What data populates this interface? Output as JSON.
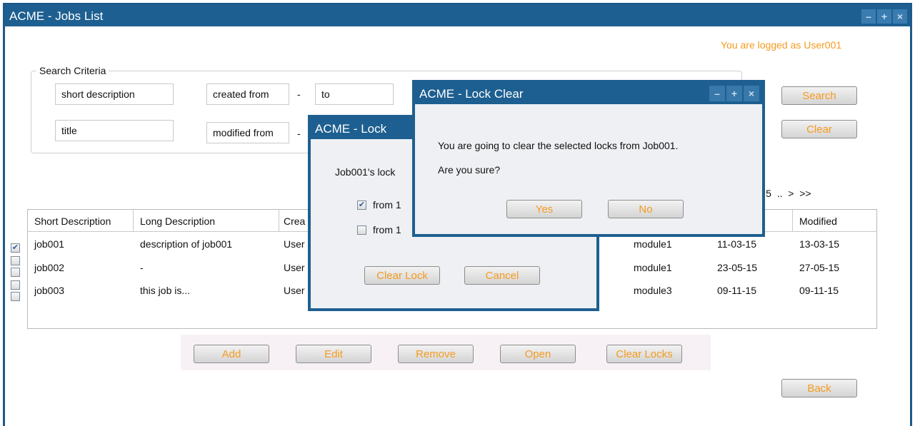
{
  "main": {
    "title": "ACME - Jobs List",
    "logged_as": "You are logged as User001",
    "window_buttons": {
      "minimize": "–",
      "maximize": "+",
      "close": "×"
    }
  },
  "search": {
    "legend": "Search Criteria",
    "short_description": "short description",
    "created_from": "created from",
    "created_dash": "-",
    "created_to": "to",
    "title": "title",
    "modified_from": "modified from",
    "modified_dash": "-",
    "search_button": "Search",
    "clear_button": "Clear"
  },
  "pagination": {
    "pages": "3  4  5  ..  >  >>"
  },
  "table": {
    "columns": [
      "Short Description",
      "Long Description",
      "Crea",
      "Modified"
    ],
    "rows": [
      {
        "checked": true,
        "short": "job001",
        "long": "description of job001",
        "creator": "User",
        "module": "module1",
        "created": "11-03-15",
        "modified": "13-03-15"
      },
      {
        "checked": false,
        "short": "job002",
        "long": "-",
        "creator": "User",
        "module": "module1",
        "created": "23-05-15",
        "modified": "27-05-15"
      },
      {
        "checked": false,
        "short": "job003",
        "long": "this job is...",
        "creator": "User",
        "module": "module3",
        "created": "09-11-15",
        "modified": "09-11-15"
      }
    ]
  },
  "actions": {
    "add": "Add",
    "edit": "Edit",
    "remove": "Remove",
    "open": "Open",
    "clear_locks": "Clear Locks",
    "back": "Back"
  },
  "lock_dialog": {
    "title": "ACME - Lock",
    "text": "Job001's lock",
    "lock1": "from 1",
    "lock2": "from 1",
    "clear_lock": "Clear Lock",
    "cancel": "Cancel"
  },
  "confirm_dialog": {
    "title": "ACME - Lock Clear",
    "line1": "You are going to clear the selected locks from Job001.",
    "line2": "Are you sure?",
    "yes": "Yes",
    "no": "No"
  },
  "colors": {
    "titlebar": "#1d5f90",
    "accent": "#f59b1f"
  }
}
